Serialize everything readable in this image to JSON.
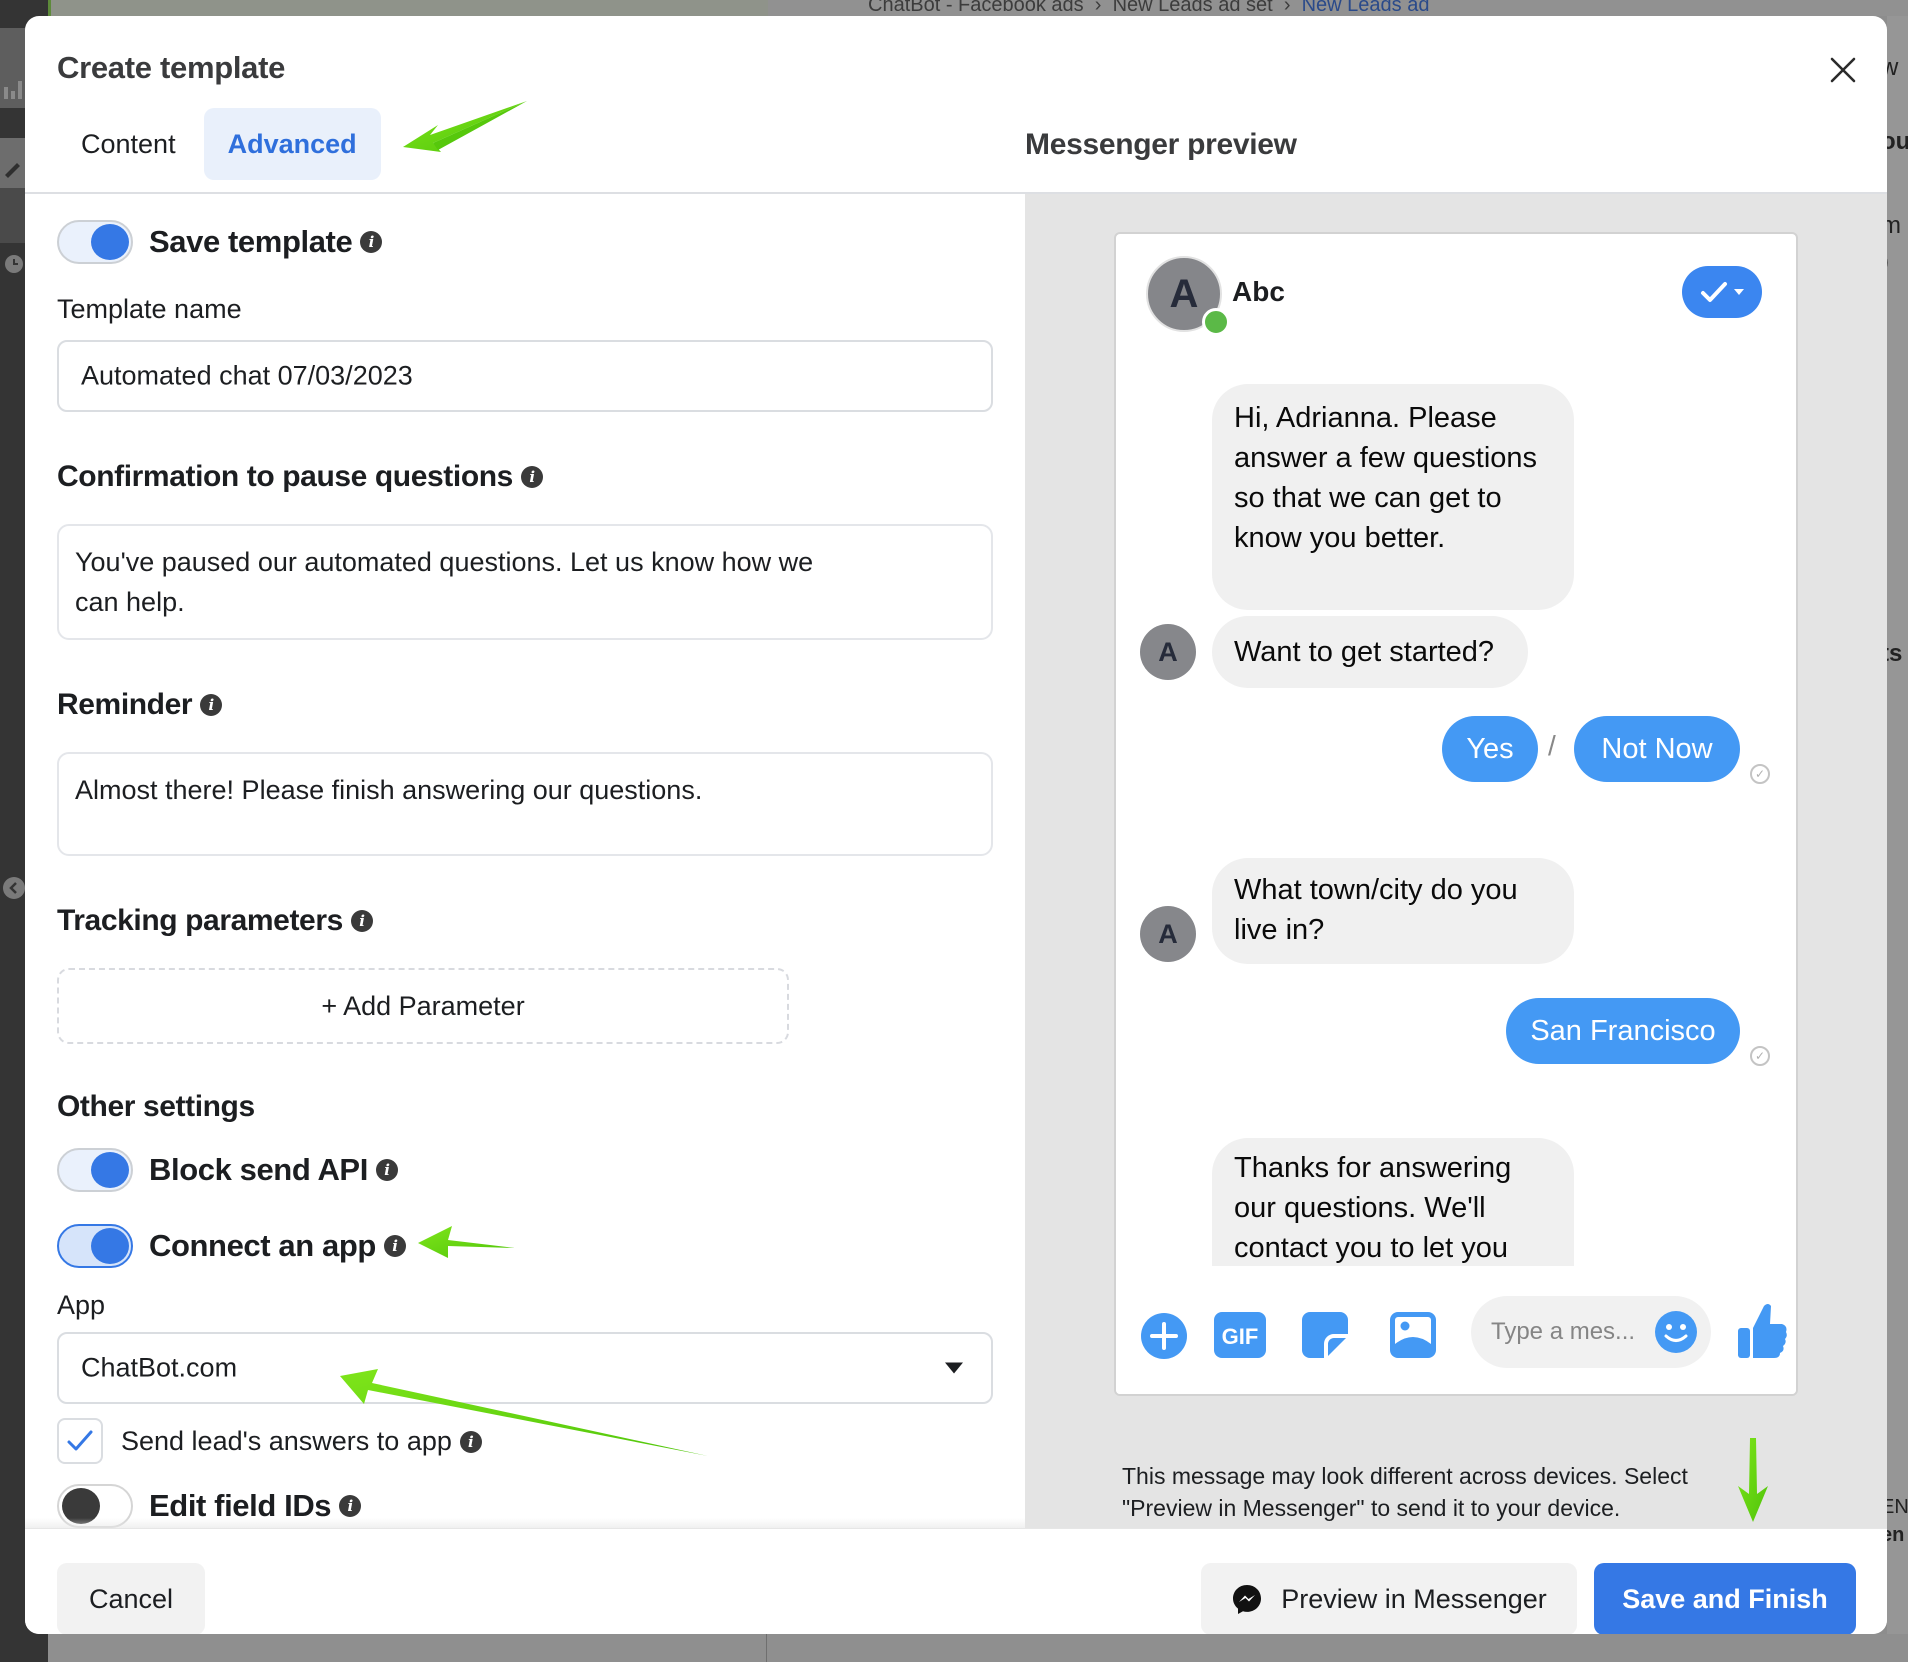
{
  "background": {
    "breadcrumbs": [
      "ChatBot - Facebook ads",
      "New Leads ad set",
      "New Leads ad"
    ],
    "right_edge_fragments": [
      "w",
      "ou",
      "m",
      ")",
      "ts",
      "EN",
      "en"
    ]
  },
  "modal": {
    "title": "Create template",
    "close_icon": "close-icon",
    "tabs": [
      {
        "label": "Content",
        "active": false
      },
      {
        "label": "Advanced",
        "active": true
      }
    ]
  },
  "form": {
    "save_template": {
      "label": "Save template",
      "enabled": true
    },
    "template_name": {
      "label": "Template name",
      "value": "Automated chat 07/03/2023"
    },
    "pause_confirmation": {
      "title": "Confirmation to pause questions",
      "value": "You've paused our automated questions. Let us know how we can help."
    },
    "reminder": {
      "title": "Reminder",
      "value": "Almost there! Please finish answering our questions."
    },
    "tracking": {
      "title": "Tracking parameters",
      "add_label": "+ Add Parameter"
    },
    "other_settings": {
      "title": "Other settings",
      "block_send_api": {
        "label": "Block send API",
        "enabled": true
      },
      "connect_app": {
        "label": "Connect an app",
        "enabled": true
      },
      "app": {
        "label": "App",
        "value": "ChatBot.com"
      },
      "send_answers": {
        "label": "Send lead's answers to app",
        "checked": true
      },
      "edit_field_ids": {
        "label": "Edit field IDs",
        "enabled": false
      }
    }
  },
  "preview": {
    "title": "Messenger preview",
    "page_name": "Abc",
    "avatar_letter": "A",
    "messages": {
      "intro": "Hi, Adrianna. Please answer a few questions so that we can get to know you better.",
      "start_question": "Want to get started?",
      "quick_replies": [
        "Yes",
        "Not Now"
      ],
      "separator": "/",
      "city_question": "What town/city do you live in?",
      "city_answer": "San Francisco",
      "thanks": "Thanks for answering our questions. We'll contact you to let you"
    },
    "composer": {
      "placeholder": "Type a mes...",
      "gif_label": "GIF"
    },
    "disclaimer": "This message may look different across devices. Select \"Preview in Messenger\" to send it to your device."
  },
  "footer": {
    "cancel_label": "Cancel",
    "preview_label": "Preview in Messenger",
    "save_label": "Save and Finish"
  },
  "colors": {
    "accent": "#3578e5",
    "bubble_out": "#4499f4",
    "annotation_arrow": "#5fd10a"
  }
}
